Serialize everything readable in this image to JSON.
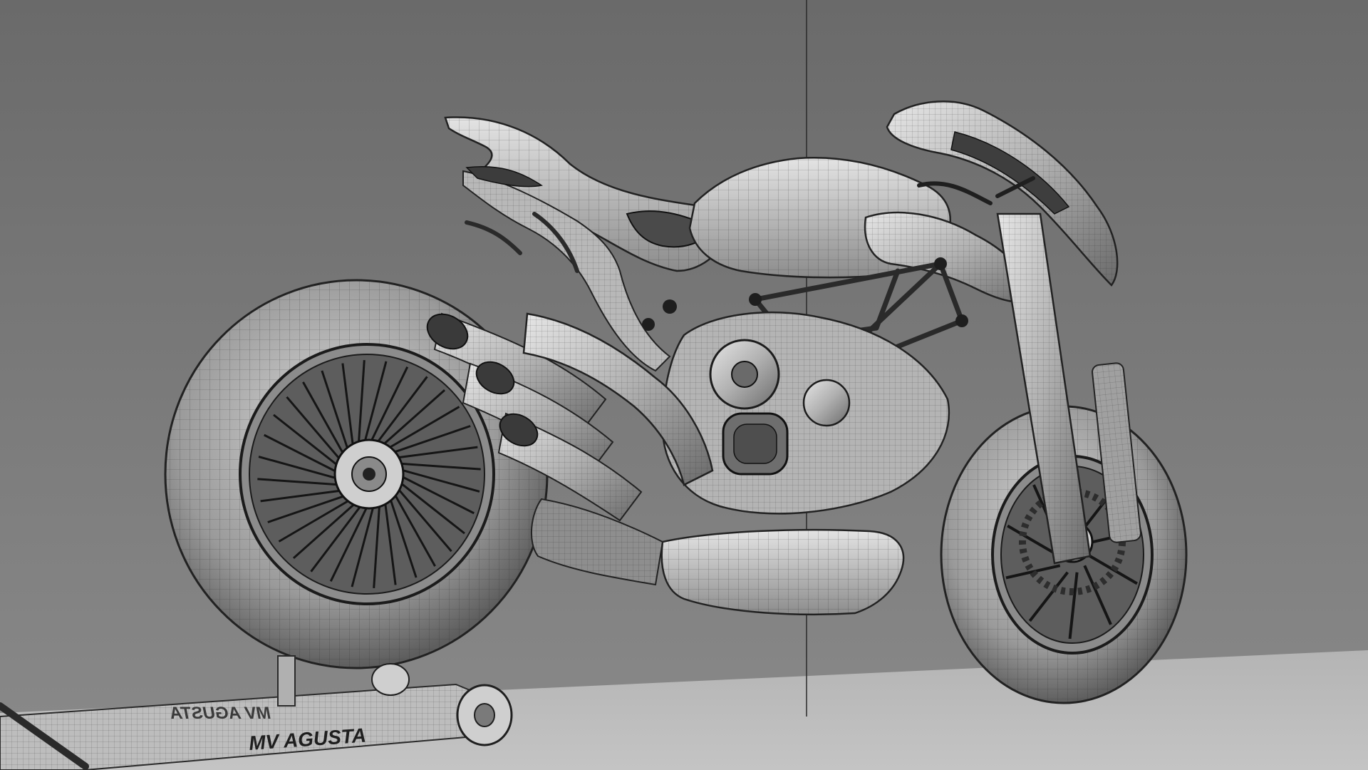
{
  "scene": {
    "description_name": "wireframe-motorcycle-render",
    "colors": {
      "background_top": "#6f6f6f",
      "background_bottom": "#8a8a8a",
      "floor": "#b9b9b9",
      "mesh_line": "#1e1e1e",
      "surface_light": "#d9d9d9",
      "surface_mid": "#a9a9a9",
      "surface_dark": "#5a5a5a"
    }
  },
  "stand": {
    "brand_text_front": "MV AGUSTA",
    "brand_text_back": "MV AGUSTA"
  }
}
